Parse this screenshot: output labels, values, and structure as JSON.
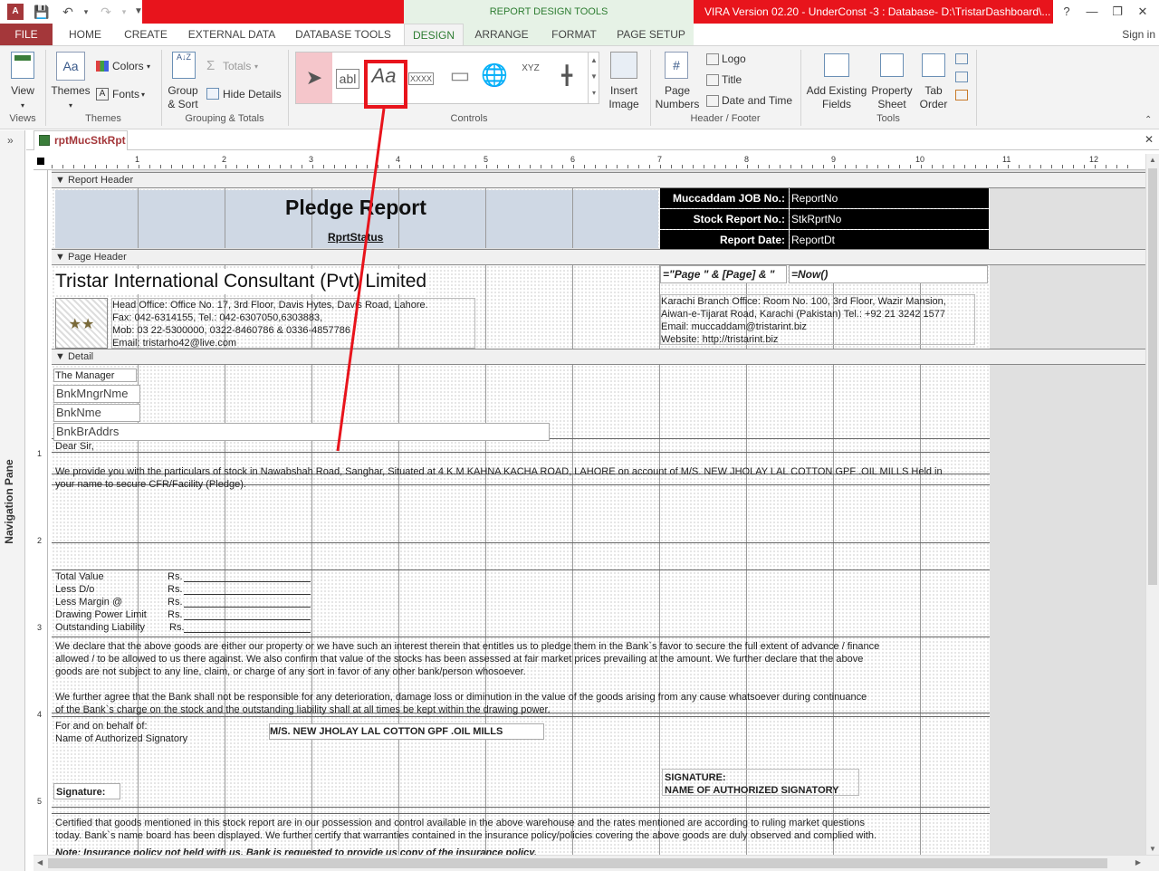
{
  "titlebar": {
    "app_icon": "A",
    "context_group": "REPORT DESIGN TOOLS",
    "title": "VIRA Version 02.20 - UnderConst -3 : Database- D:\\TristarDashboard\\...",
    "help": "?",
    "minimize": "—",
    "restore": "❐",
    "close": "✕"
  },
  "tabs": {
    "file": "FILE",
    "home": "HOME",
    "create": "CREATE",
    "external": "EXTERNAL DATA",
    "dbtools": "DATABASE TOOLS",
    "design": "DESIGN",
    "arrange": "ARRANGE",
    "format": "FORMAT",
    "pagesetup": "PAGE SETUP",
    "signin": "Sign in"
  },
  "ribbon": {
    "view": "View",
    "themes": "Themes",
    "colors": "Colors",
    "fonts": "Fonts",
    "group_sort_1": "Group",
    "group_sort_2": "& Sort",
    "totals": "Totals",
    "hide_details": "Hide Details",
    "insert_image_1": "Insert",
    "insert_image_2": "Image",
    "page_numbers_1": "Page",
    "page_numbers_2": "Numbers",
    "logo": "Logo",
    "title": "Title",
    "date_time": "Date and Time",
    "add_fields_1": "Add Existing",
    "add_fields_2": "Fields",
    "prop_sheet_1": "Property",
    "prop_sheet_2": "Sheet",
    "tab_order_1": "Tab",
    "tab_order_2": "Order",
    "groups": {
      "views": "Views",
      "themes": "Themes",
      "grouping": "Grouping & Totals",
      "controls": "Controls",
      "header_footer": "Header / Footer",
      "tools": "Tools"
    },
    "controls": {
      "textbox": "abl",
      "label": "Aa",
      "button": "XXXX",
      "combo": "XYZ"
    }
  },
  "nav": {
    "label": "Navigation Pane",
    "toggle": "»"
  },
  "document": {
    "tab": "rptMucStkRpt",
    "close": "✕"
  },
  "ruler": [
    "1",
    "2",
    "3",
    "4",
    "5",
    "6",
    "7",
    "8",
    "9",
    "10",
    "11",
    "12"
  ],
  "vruler": [
    "1",
    "2",
    "3",
    "4",
    "5"
  ],
  "report": {
    "sec_report_header": "Report Header",
    "sec_page_header": "Page Header",
    "sec_detail": "Detail",
    "title": "Pledge Report",
    "status": "RprtStatus",
    "job_label": "Muccaddam JOB No.:",
    "job_value": "ReportNo",
    "stk_label": "Stock Report No.:",
    "stk_value": "StkRprtNo",
    "date_label": "Report Date:",
    "date_value": "ReportDt",
    "company": "Tristar International Consultant (Pvt) Limited",
    "page_expr": "=\"Page \" & [Page] & \"",
    "now_expr": "=Now()",
    "head_office_1": "Head Office: Office No. 17, 3rd Floor, Davis Hytes, Davis Road, Lahore.",
    "head_office_2": "Fax: 042-6314155, Tel.: 042-6307050,6303883,",
    "head_office_3": "Mob: 03 22-5300000, 0322-8460786 & 0336-4857786",
    "head_office_4": "Email: tristarho42@live.com",
    "karachi_1": "Karachi Branch Office: Room No. 100, 3rd Floor, Wazir Mansion,",
    "karachi_2": "Aiwan-e-Tijarat Road, Karachi (Pakistan) Tel.: +92 21 3242 1577",
    "karachi_3": "Email: muccaddam@tristarint.biz",
    "karachi_4": "Website: http://tristarint.biz",
    "manager": "The Manager",
    "mngr_field": "BnkMngrNme",
    "bank_field": "BnkNme",
    "addr_field": "BnkBrAddrs",
    "dear": "Dear Sir,",
    "particulars_1": "We provide you with the particulars of stock in Nawabshah Road, Sanghar, Situated at 4 K.M KAHNA KACHA ROAD, LAHORE on account of M/S. NEW JHOLAY LAL COTTON GPF .OIL MILLS Held in",
    "particulars_2": "your name to secure CFR/Facility (Pledge).",
    "total_value": "Total Value",
    "less_do": "Less D/o",
    "less_margin": "Less Margin @",
    "drawing_power": "Drawing Power Limit",
    "outstanding": "Outstanding Liability",
    "rs": "Rs.",
    "declare_1": "We declare that the above goods are either our property or we have such an interest therein that entitles us to pledge them in the Bank`s favor to secure the full extent of advance / finance",
    "declare_2": "allowed / to be allowed to us there against. We also confirm that value of the stocks has been assessed at fair market prices prevailing at the amount. We further declare that the above",
    "declare_3": "goods are not subject to any line, claim, or charge of any sort in favor of any other bank/person whosoever.",
    "agree_1": "We further agree that the Bank shall not be responsible for any deterioration, damage loss or diminution in the value of the goods arising from any cause whatsoever during continuance",
    "agree_2": "of the Bank`s charge on the stock and the outstanding liability shall at all times be kept within the drawing power.",
    "behalf": "For and on behalf of:",
    "auth_name": "Name of Authorized Signatory",
    "mill_name": "M/S. NEW JHOLAY LAL COTTON GPF .OIL MILLS",
    "signature_caps": "SIGNATURE:",
    "auth_caps": "NAME OF AUTHORIZED SIGNATORY",
    "signature": "Signature:",
    "certified_1": "Certified that goods mentioned in this stock report are in our possession and control available in the above warehouse and the rates mentioned are according to ruling market questions",
    "certified_2": "today. Bank`s name board has been displayed. We further certify that warranties contained in the insurance policy/policies covering the above goods are duly observed and complied with.",
    "certified_3": "Note: Insurance policy not held with us. Bank is requested to provide us copy of the insurance policy."
  }
}
